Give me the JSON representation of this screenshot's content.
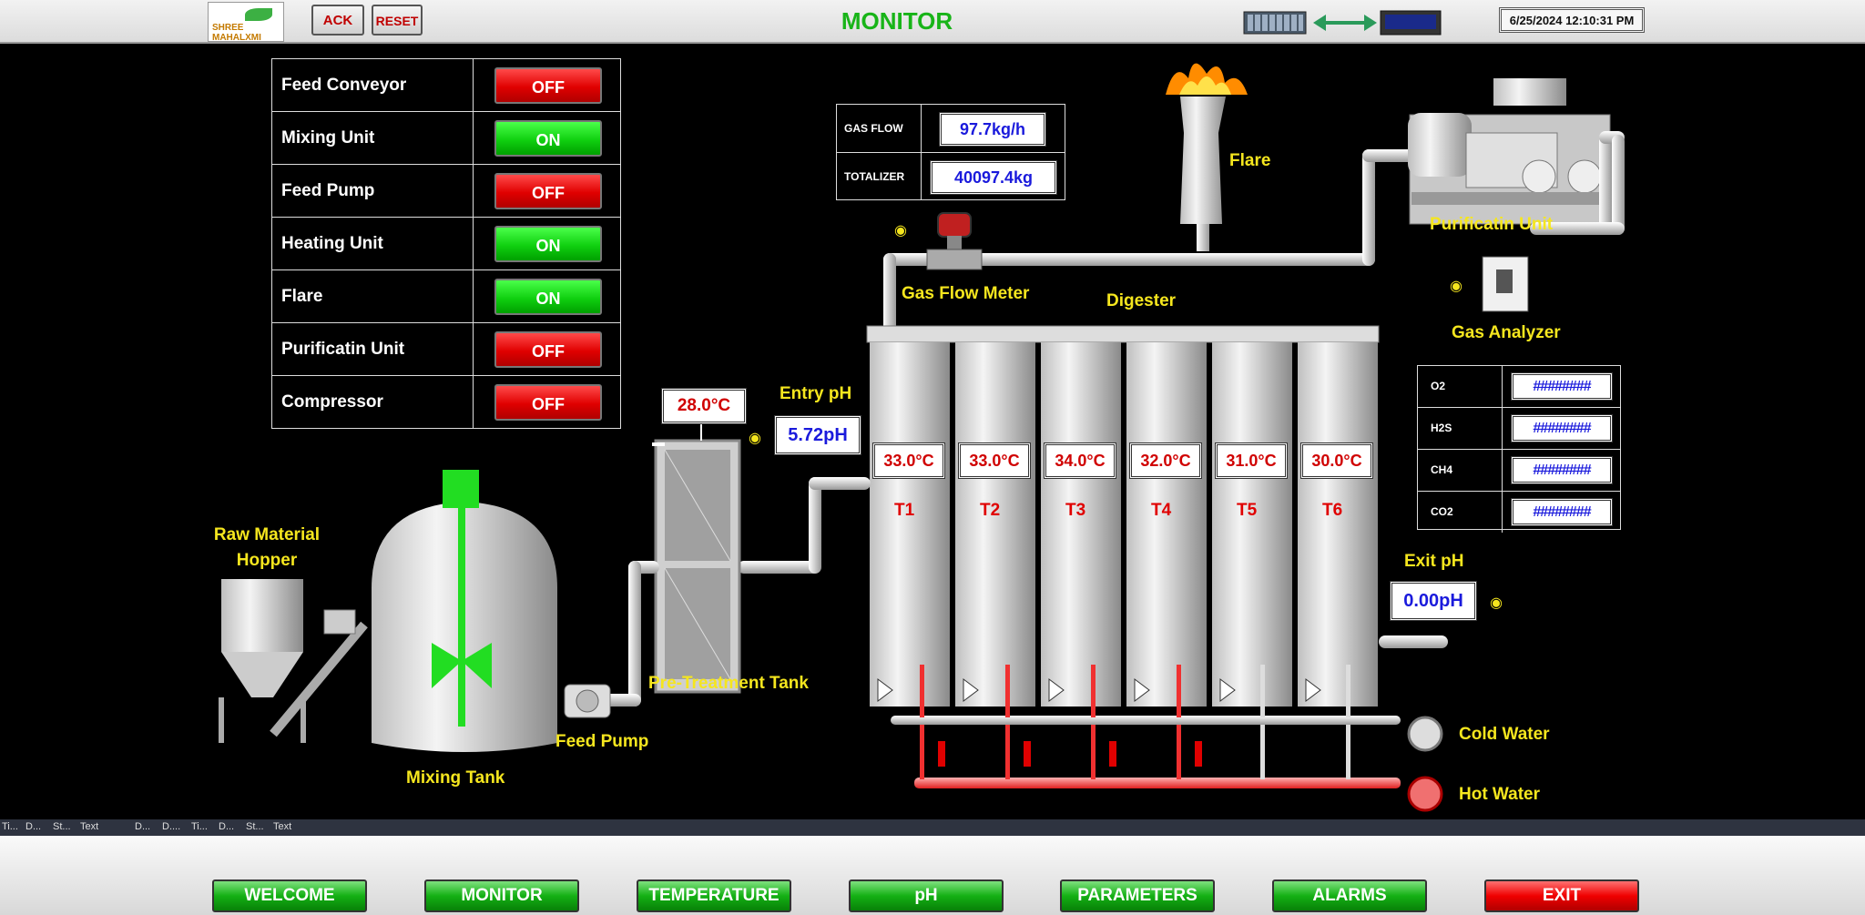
{
  "header": {
    "logo_text": "SHREE MAHALXMI",
    "ack_label": "ACK",
    "reset_label": "RESET",
    "title": "MONITOR",
    "datetime": "6/25/2024 12:10:31 PM"
  },
  "status_table": [
    {
      "label": "Feed Conveyor",
      "state": "OFF"
    },
    {
      "label": "Mixing Unit",
      "state": "ON"
    },
    {
      "label": "Feed Pump",
      "state": "OFF"
    },
    {
      "label": "Heating Unit",
      "state": "ON"
    },
    {
      "label": "Flare",
      "state": "ON"
    },
    {
      "label": "Purificatin Unit",
      "state": "OFF"
    },
    {
      "label": "Compressor",
      "state": "OFF"
    }
  ],
  "gas_flow": {
    "flow_label": "GAS FLOW",
    "flow_value": "97.7kg/h",
    "totalizer_label": "TOTALIZER",
    "totalizer_value": "40097.4kg"
  },
  "labels": {
    "flare": "Flare",
    "purification_unit": "Purificatin Unit",
    "gas_analyzer": "Gas Analyzer",
    "gas_flow_meter": "Gas Flow Meter",
    "digester": "Digester",
    "entry_ph": "Entry pH",
    "exit_ph": "Exit pH",
    "raw_material_hopper": "Raw Material Hopper",
    "mixing_tank": "Mixing Tank",
    "feed_pump": "Feed Pump",
    "pre_treatment_tank": "Pre-Treatment Tank",
    "cold_water": "Cold Water",
    "hot_water": "Hot Water"
  },
  "readings": {
    "pretreat_temp": "28.0°C",
    "entry_ph": "5.72pH",
    "exit_ph": "0.00pH"
  },
  "digester_tanks": [
    {
      "name": "T1",
      "temp": "33.0°C"
    },
    {
      "name": "T2",
      "temp": "33.0°C"
    },
    {
      "name": "T3",
      "temp": "34.0°C"
    },
    {
      "name": "T4",
      "temp": "32.0°C"
    },
    {
      "name": "T5",
      "temp": "31.0°C"
    },
    {
      "name": "T6",
      "temp": "30.0°C"
    }
  ],
  "gas_analyzer": [
    {
      "label": "O2",
      "value": "########"
    },
    {
      "label": "H2S",
      "value": "########"
    },
    {
      "label": "CH4",
      "value": "########"
    },
    {
      "label": "CO2",
      "value": "########"
    }
  ],
  "alarm_log_columns": [
    "Ti...",
    "D...",
    "St...",
    "Text",
    "D...",
    "D....",
    "Ti...",
    "D...",
    "St...",
    "Text"
  ],
  "nav": [
    "WELCOME",
    "MONITOR",
    "TEMPERATURE",
    "pH",
    "PARAMETERS",
    "ALARMS",
    "EXIT"
  ],
  "colors": {
    "on": "#10d010",
    "off": "#e00000",
    "label_yellow": "#f5e61e",
    "title_green": "#18b418"
  },
  "icons": [
    "flame-icon",
    "eye-icon",
    "plc-rack-icon",
    "screen-icon",
    "sync-arrow-icon",
    "pump-icon"
  ]
}
